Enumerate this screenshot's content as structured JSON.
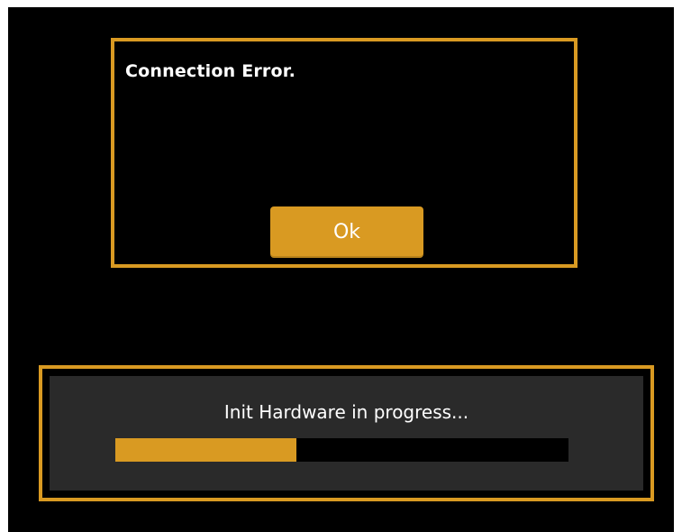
{
  "error_dialog": {
    "message": "Connection Error.",
    "ok_label": "Ok"
  },
  "progress_panel": {
    "status_text": "Init Hardware in progress...",
    "progress_fraction": 0.4
  },
  "colors": {
    "accent": "#d99a22",
    "background": "#000000",
    "panel_inner": "#2a2a2a",
    "text": "#ffffff"
  }
}
